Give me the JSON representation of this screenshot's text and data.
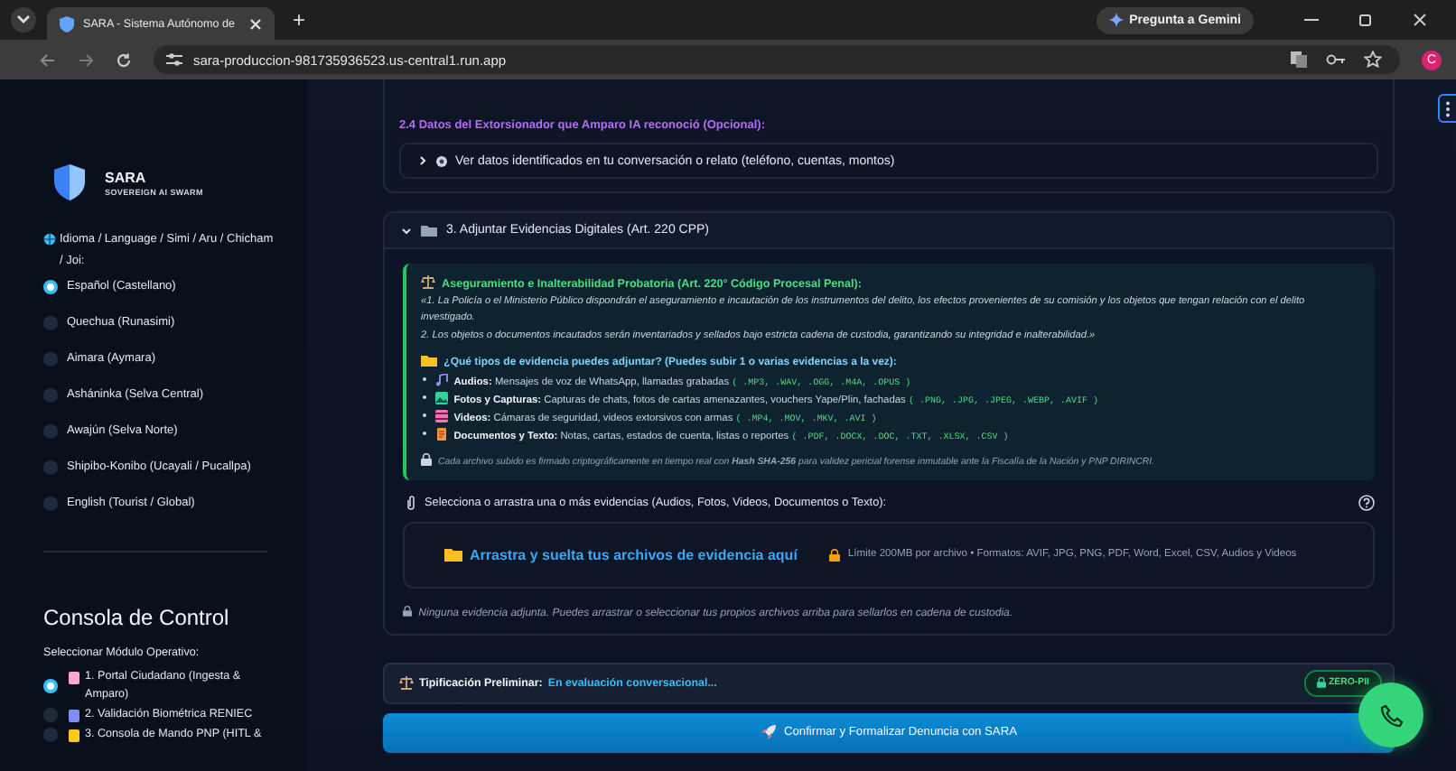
{
  "browser": {
    "tab_title": "SARA - Sistema Autónomo de",
    "new_tab": "+",
    "gemini_button": "Pregunta a Gemini",
    "url": "sara-produccion-981735936523.us-central1.run.app",
    "profile": "C"
  },
  "sidebar": {
    "brand": "SARA",
    "tagline": "SOVEREIGN AI SWARM",
    "language_label": "Idioma / Language / Simi / Aru / Chicham / Joi:",
    "languages": [
      {
        "label": "Español (Castellano)",
        "selected": true
      },
      {
        "label": "Quechua (Runasimi)",
        "selected": false
      },
      {
        "label": "Aimara (Aymara)",
        "selected": false
      },
      {
        "label": "Asháninka (Selva Central)",
        "selected": false
      },
      {
        "label": "Awajún (Selva Norte)",
        "selected": false
      },
      {
        "label": "Shipibo-Konibo (Ucayali / Pucallpa)",
        "selected": false
      },
      {
        "label": "English (Tourist / Global)",
        "selected": false
      }
    ],
    "console_title": "Consola de Control",
    "module_label": "Seleccionar Módulo Operativo:",
    "modules": [
      {
        "label": "1. Portal Ciudadano (Ingesta & Amparo)",
        "selected": true
      },
      {
        "label": "2. Validación Biométrica RENIEC",
        "selected": false
      },
      {
        "label": "3. Consola de Mando PNP (HITL &",
        "selected": false
      }
    ]
  },
  "extortionist": {
    "title": "2.4 Datos del Extorsionador que Amparo IA reconoció (Opcional):",
    "expander": {
      "label": "Ver datos identificados en tu conversación o relato (teléfono, cuentas, montos)",
      "expanded": false
    }
  },
  "evidence_section": {
    "title": "3. Adjuntar Evidencias Digitales (Art. 220 CPP)",
    "expanded": true,
    "legal_title": "Aseguramiento e Inalterabilidad Probatoria (Art. 220° Código Procesal Penal):",
    "legal_paragraphs": [
      "«1. La Policía o el Ministerio Público dispondrán el aseguramiento e incautación de los instrumentos del delito, los efectos provenientes de su comisión y los objetos que tengan relación con el delito investigado.",
      "2. Los objetos o documentos incautados serán inventariados y sellados bajo estricta cadena de custodia, garantizando su integridad e inalterabilidad.»"
    ],
    "types_title": "¿Qué tipos de evidencia puedes adjuntar? (Puedes subir 1 o varias evidencias a la vez):",
    "types": [
      {
        "kind": "audio",
        "name": "Audios:",
        "text": "Mensajes de voz de WhatsApp, llamadas grabadas",
        "formats": "( .MP3, .WAV, .OGG, .M4A, .OPUS )"
      },
      {
        "kind": "image",
        "name": "Fotos y Capturas:",
        "text": "Capturas de chats, fotos de cartas amenazantes, vouchers Yape/Plin, fachadas",
        "formats": "( .PNG, .JPG, .JPEG, .WEBP, .AVIF )"
      },
      {
        "kind": "video",
        "name": "Videos:",
        "text": "Cámaras de seguridad, videos extorsivos con armas",
        "formats": "( .MP4, .MOV, .MKV, .AVI )"
      },
      {
        "kind": "document",
        "name": "Documentos y Texto:",
        "text": "Notas, cartas, estados de cuenta, listas o reportes",
        "formats": "( .PDF, .DOCX, .DOC, .TXT, .XLSX, .CSV )"
      }
    ],
    "hash_note": "Cada archivo subido es firmado criptográficamente en tiempo real con **Hash SHA-256** para validez pericial forense inmutable ante la Fiscalía de la Nación y PNP DIRINCRI.",
    "upload_label": "Selecciona o arrastra una o más evidencias (Audios, Fotos, Videos, Documentos o Texto):",
    "dropzone_text": "Arrastra y suelta tus archivos de evidencia aquí",
    "dropzone_limit": "Límite 200MB por archivo • Formatos: AVIF, JPG, PNG, PDF, Word, Excel, CSV, Audios y Videos",
    "empty_note": "Ninguna evidencia adjunta. Puedes arrastrar o seleccionar tus propios archivos arriba para sellarlos en cadena de custodia."
  },
  "classification": {
    "label": "Tipificación Preliminar:",
    "value": "En evaluación conversacional...",
    "badge": "ZERO-PII"
  },
  "submit_button": "Confirmar y Formalizar Denuncia con SARA"
}
